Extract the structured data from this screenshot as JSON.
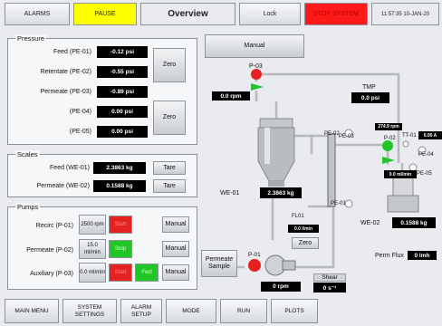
{
  "topbar": {
    "alarms": "ALARMS",
    "pause": "PAUSE",
    "title": "Overview",
    "lock": "Lock",
    "stop_system": "STOP SYSTEM",
    "clock": "11:57:35 10-JAN-20"
  },
  "pressure": {
    "title": "Pressure",
    "rows": [
      {
        "label": "Feed  (PE-01)",
        "value": "-0.12 psi"
      },
      {
        "label": "Retentate  (PE-02)",
        "value": "-0.55 psi"
      },
      {
        "label": "Permeate  (PE-03)",
        "value": "-0.89 psi"
      },
      {
        "label": "(PE-04)",
        "value": "0.00 psi"
      },
      {
        "label": "(PE-05)",
        "value": "0.00 psi"
      }
    ],
    "zero1": "Zero",
    "zero2": "Zero"
  },
  "scales": {
    "title": "Scales",
    "rows": [
      {
        "label": "Feed  (WE-01)",
        "value": "2.3863 kg",
        "button": "Tare"
      },
      {
        "label": "Permeate  (WE-02)",
        "value": "0.1588 kg",
        "button": "Tare"
      }
    ]
  },
  "pumps": {
    "title": "Pumps",
    "rows": [
      {
        "label": "Recirc (P-01)",
        "speed": "2500 rpm",
        "start": "Start",
        "mode": "Manual"
      },
      {
        "label": "Permeate (P-02)",
        "speed": "15.0 ml/min",
        "stop": "Stop",
        "mode": "Manual"
      },
      {
        "label": "Auxiliary (P-03)",
        "speed": "0.0 ml/min",
        "start": "Start",
        "fwd": "Fwd",
        "mode": "Manual"
      }
    ]
  },
  "diagram": {
    "manual": "Manual",
    "p03": "P-03",
    "p03_rpm": "0.0 rpm",
    "tmp_label": "TMP",
    "tmp_value": "0.0 psi",
    "pe02": "PE-02",
    "pe03": "PE-03",
    "pe01": "PE-01",
    "we01": "WE-01",
    "we01_value": "2.3863 kg",
    "p02_rpm": "274.9 rpm",
    "p02": "P-02",
    "tt01": "TT-01",
    "tt01_value": "0.00 A",
    "pe04": "PE-04",
    "p02_flow": "0.0 ml/min",
    "pe05": "PE-05",
    "fl01": "FL01",
    "fl01_value": "0.0 l/min",
    "zero": "Zero",
    "we02": "WE-02",
    "we02_value": "0.1588 kg",
    "perm_flux": "Perm Flux",
    "perm_flux_value": "0 lmh",
    "permeate_sample": "Permeate Sample",
    "p01": "P-01",
    "p01_rpm": "0 rpm",
    "shear": "Shear",
    "shear_value": "0 s⁻¹"
  },
  "bottom": {
    "main_menu": "MAIN MENU",
    "system_settings": "SYSTEM SETTINGS",
    "alarm_setup": "ALARM SETUP",
    "mode": "MODE",
    "run": "RUN",
    "plots": "PLOTS"
  },
  "colors": {
    "pause": "#ffff00",
    "stop": "#ff1a1a",
    "start": "#e52222",
    "run": "#21c626"
  }
}
